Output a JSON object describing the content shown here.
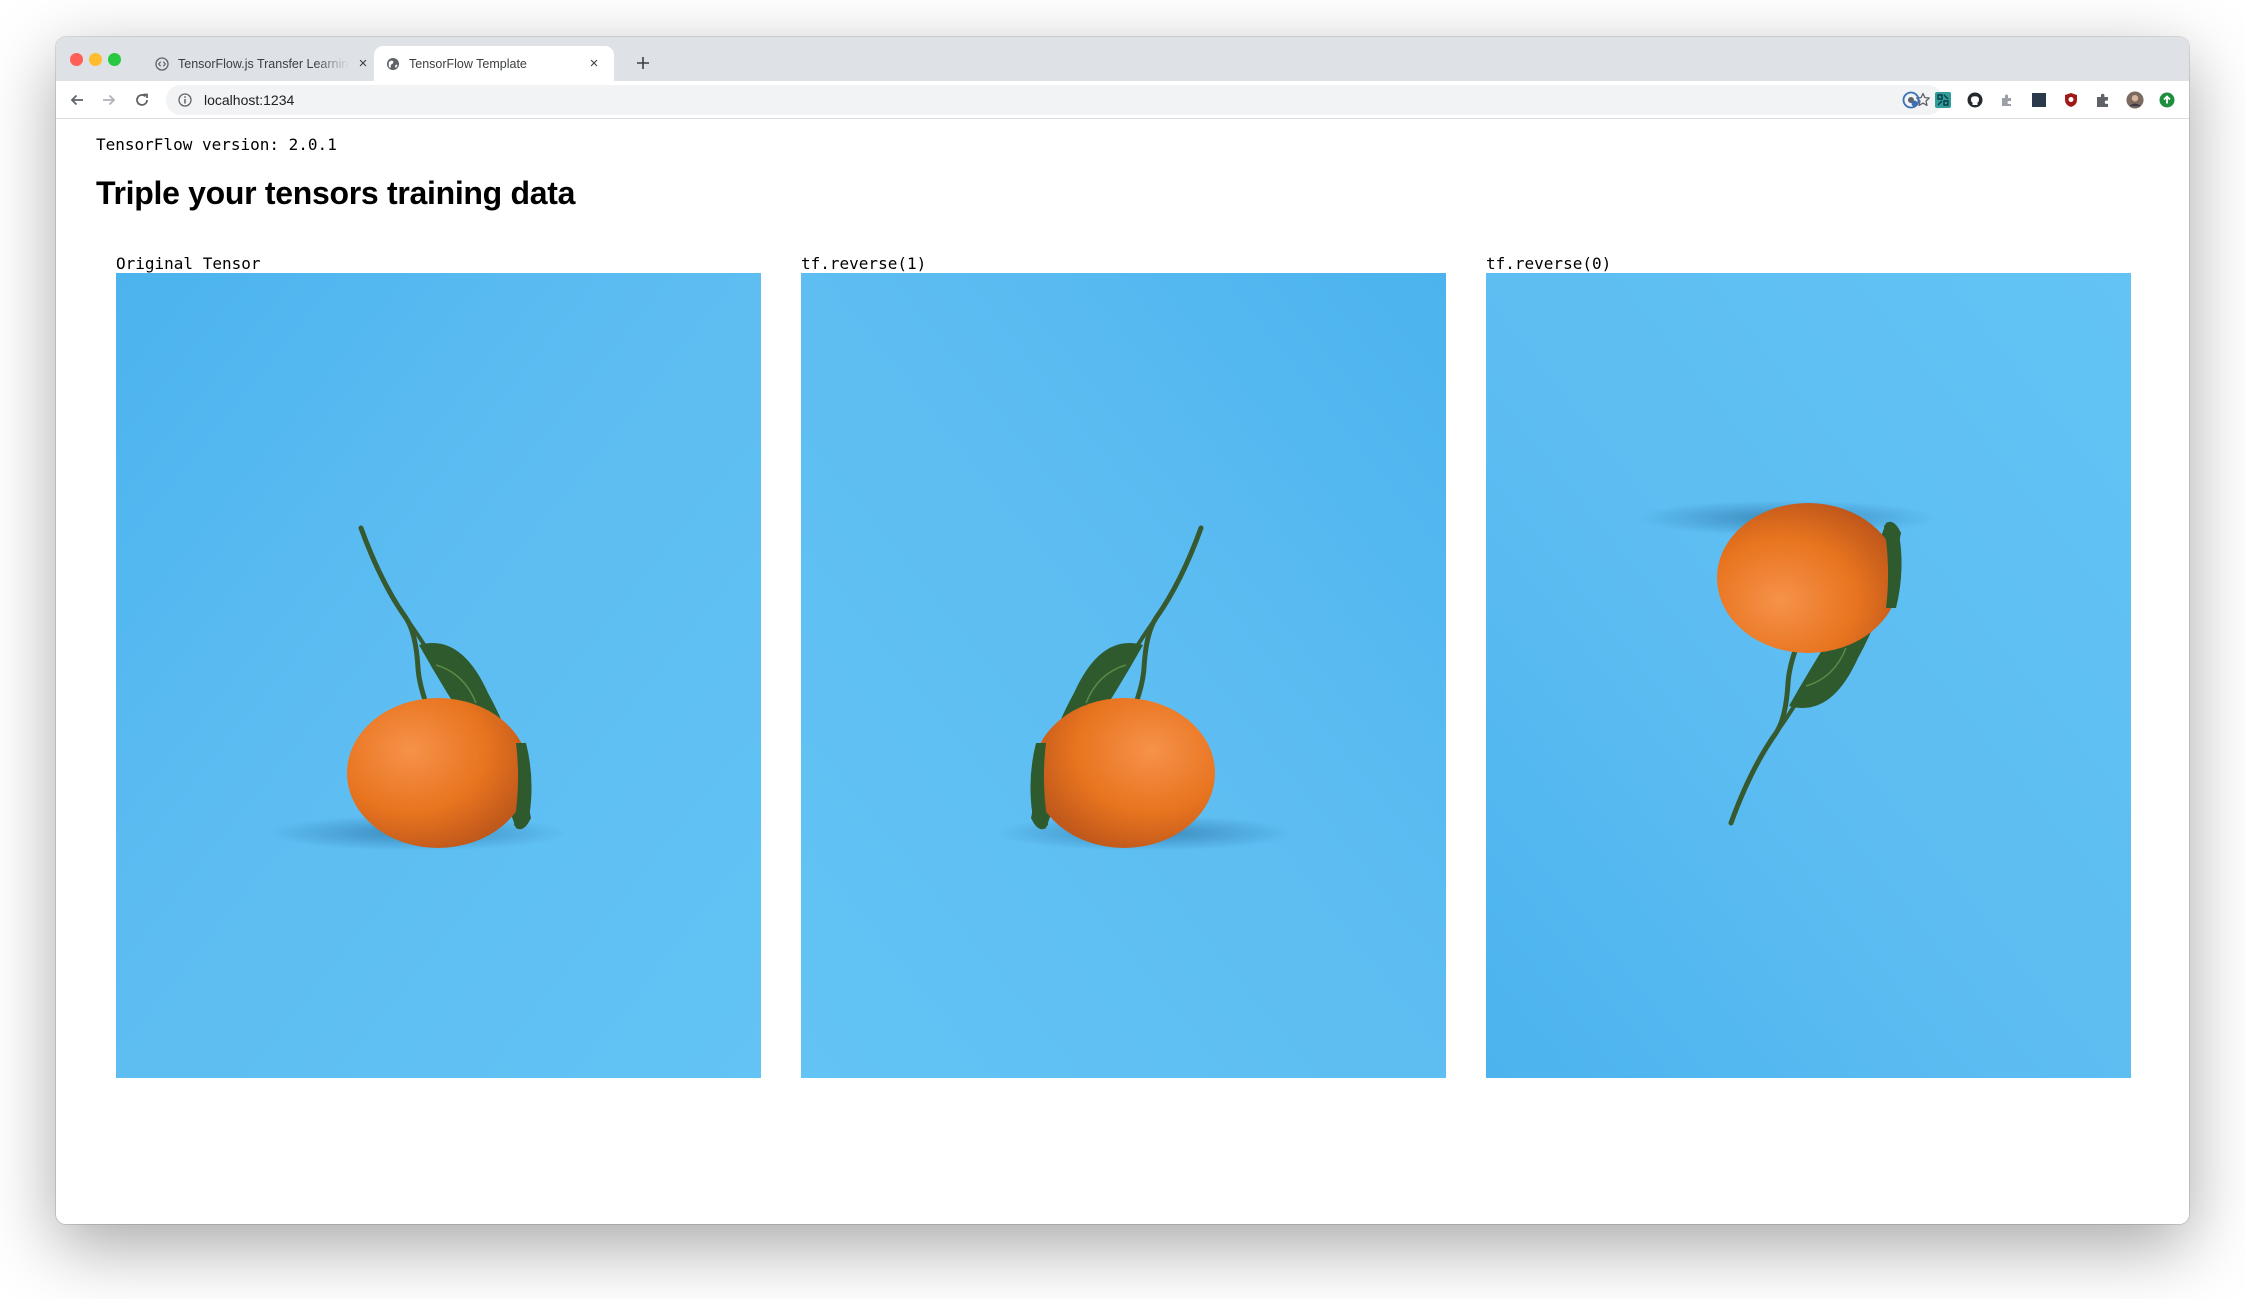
{
  "browser": {
    "tabs": [
      {
        "title": "TensorFlow.js Transfer Learning",
        "active": false,
        "favicon": "code-icon"
      },
      {
        "title": "TensorFlow Template",
        "active": true,
        "favicon": "globe-icon"
      }
    ],
    "url": "localhost:1234",
    "extensions": [
      "account-circle-icon",
      "qr-icon",
      "github-icon",
      "puzzle-gray-icon",
      "square-dark-icon",
      "shield-red-icon",
      "extensions-puzzle-icon",
      "profile-avatar-icon",
      "update-icon"
    ]
  },
  "page": {
    "version_text": "TensorFlow version: 2.0.1",
    "headline": "Triple your tensors training data",
    "panels": [
      {
        "caption": "Original Tensor",
        "image": "orange-original"
      },
      {
        "caption": "tf.reverse(1)",
        "image": "orange-horizontal-flip"
      },
      {
        "caption": "tf.reverse(0)",
        "image": "orange-vertical-flip"
      }
    ]
  },
  "colors": {
    "background_blue": "#5bbcf1",
    "orange": "#ec7a28",
    "leaf": "#2f5a2e",
    "chrome_tabstrip": "#dee1e6",
    "omnibox": "#f1f3f4"
  }
}
